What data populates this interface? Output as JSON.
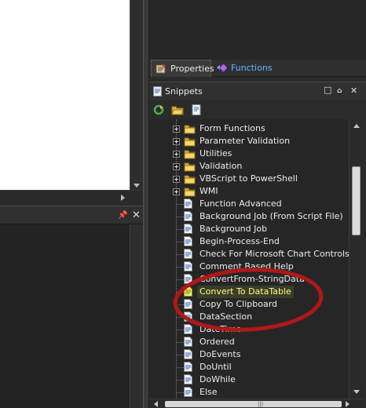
{
  "tabs": [
    {
      "label": "Properties",
      "icon": "properties-icon"
    },
    {
      "label": "Functions",
      "icon": "functions-icon",
      "color": "#6ab4ff"
    }
  ],
  "snippets_panel": {
    "title": "Snippets",
    "toolbar": [
      "refresh-icon",
      "open-folder-icon",
      "new-snippet-icon"
    ]
  },
  "tree": {
    "folders": [
      "Form Functions",
      "Parameter Validation",
      "Utilities",
      "Validation",
      "VBScript to PowerShell",
      "WMI"
    ],
    "snippets": [
      "Function Advanced",
      "Background Job (From Script File)",
      "Background Job",
      "Begin-Process-End",
      "Check For Microsoft Chart Controls",
      "Comment Based Help",
      "ConvertFrom-StringData",
      "Convert To DataTable",
      "Copy To Clipboard",
      "DataSection",
      "DateTime",
      "Ordered",
      "DoEvents",
      "DoUntil",
      "DoWhile",
      "Else"
    ],
    "selected": "Convert To DataTable"
  },
  "colors": {
    "annotation": "#b01818",
    "selected_text": "#ffff80",
    "functions_tab": "#6ab4ff"
  }
}
